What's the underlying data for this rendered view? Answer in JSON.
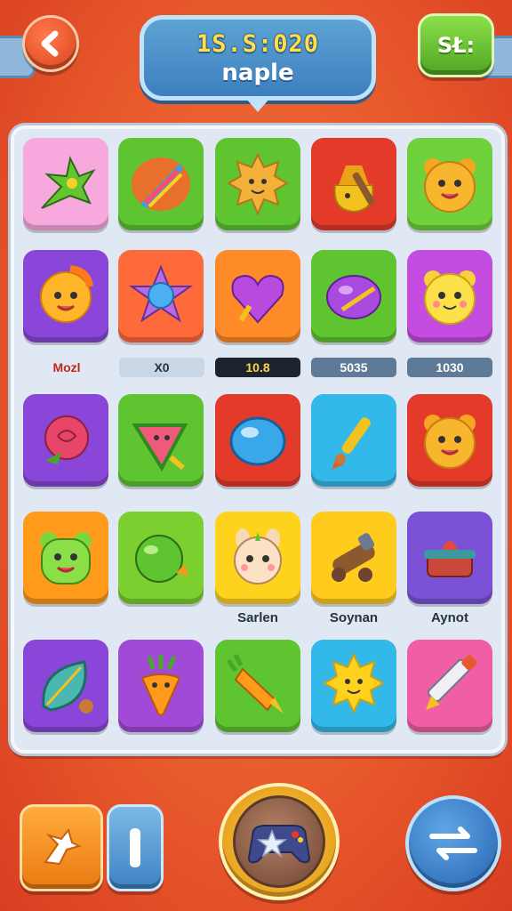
{
  "header": {
    "score": "1S.S:020",
    "name": "naple",
    "menu_label": "SŁ:",
    "back_icon": "chevron-left-icon"
  },
  "board": {
    "rows": [
      {
        "tiles": [
          {
            "icon": "spiky-leaf-icon",
            "color": "#f7a8dc"
          },
          {
            "icon": "rainbow-feather-icon",
            "color": "#5ec531"
          },
          {
            "icon": "spiky-fruit-icon",
            "color": "#5ec531"
          },
          {
            "icon": "treasure-sack-icon",
            "color": "#e43a2a"
          },
          {
            "icon": "bear-face-icon",
            "color": "#6fd23d"
          }
        ]
      },
      {
        "tiles": [
          {
            "icon": "sun-face-icon",
            "color": "#8a46d8"
          },
          {
            "icon": "crystal-star-icon",
            "color": "#ff6a3a"
          },
          {
            "icon": "purple-heart-gem-icon",
            "color": "#ff8a28"
          },
          {
            "icon": "purple-lemon-icon",
            "color": "#5ec531"
          },
          {
            "icon": "yellow-bear-icon",
            "color": "#c44ce0"
          }
        ],
        "labels": [
          "Mozl",
          "X0",
          "10.8",
          "5035",
          "1030"
        ]
      },
      {
        "tiles": [
          {
            "icon": "rose-icon",
            "color": "#8a46d8"
          },
          {
            "icon": "watermelon-icon",
            "color": "#5ec531"
          },
          {
            "icon": "blue-orb-icon",
            "color": "#e43a2a"
          },
          {
            "icon": "paintbrush-icon",
            "color": "#33b8ea"
          },
          {
            "icon": "bear-face-icon",
            "color": "#e43a2a"
          }
        ]
      },
      {
        "tiles": [
          {
            "icon": "green-bear-icon",
            "color": "#ff9a1a"
          },
          {
            "icon": "green-apple-icon",
            "color": "#7bd02f"
          },
          {
            "icon": "bunny-face-icon",
            "color": "#ffd21e"
          },
          {
            "icon": "wooden-cannon-icon",
            "color": "#ffcc1e"
          },
          {
            "icon": "cake-stand-icon",
            "color": "#7b52d6"
          }
        ],
        "labels": [
          "Sarlen",
          "Soynan",
          "Aynot"
        ]
      },
      {
        "tiles": [
          {
            "icon": "blue-leaf-icon",
            "color": "#8a46d8"
          },
          {
            "icon": "carrot-face-icon",
            "color": "#a24ad8"
          },
          {
            "icon": "carrot-icon",
            "color": "#5ec531"
          },
          {
            "icon": "sun-smile-icon",
            "color": "#33b8ea"
          },
          {
            "icon": "pencil-icon",
            "color": "#f05fa6"
          }
        ]
      }
    ]
  },
  "controls": {
    "left_icon": "bird-icon",
    "left2_icon": "pause-bar-icon",
    "center_icon": "gamepad-star-icon",
    "right_icon": "exchange-arrows-icon"
  }
}
